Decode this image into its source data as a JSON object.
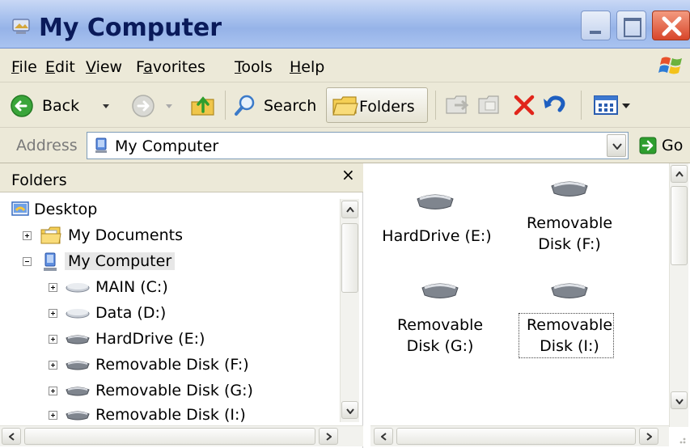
{
  "window": {
    "title": "My Computer",
    "controls": {
      "minimize": "minimize",
      "maximize": "maximize",
      "close": "close"
    }
  },
  "menu": {
    "items": [
      {
        "key": "F",
        "rest": "ile"
      },
      {
        "key": "E",
        "rest": "dit"
      },
      {
        "key": "V",
        "rest": "iew"
      },
      {
        "pre": "F",
        "key": "a",
        "rest": "vorites"
      },
      {
        "key": "T",
        "rest": "ools"
      },
      {
        "key": "H",
        "rest": "elp"
      }
    ]
  },
  "toolbar": {
    "back_label": "Back",
    "search_label": "Search",
    "folders_label": "Folders"
  },
  "address": {
    "label": "Address",
    "value": "My Computer",
    "go_label": "Go"
  },
  "folders_pane": {
    "title": "Folders",
    "close_glyph": "×",
    "tree": [
      {
        "label": "Desktop"
      },
      {
        "label": "My Documents"
      },
      {
        "label": "My Computer"
      },
      {
        "label": "MAIN (C:)"
      },
      {
        "label": "Data (D:)"
      },
      {
        "label": "HardDrive (E:)"
      },
      {
        "label": "Removable Disk (F:)"
      },
      {
        "label": "Removable Disk (G:)"
      },
      {
        "label": "Removable Disk (I:)"
      }
    ]
  },
  "content": {
    "drives": [
      {
        "line1": "HardDrive (E:)",
        "line2": ""
      },
      {
        "line1": "Removable",
        "line2": "Disk (F:)"
      },
      {
        "line1": "Removable",
        "line2": "Disk (G:)"
      },
      {
        "line1": "Removable",
        "line2": "Disk (I:)"
      }
    ]
  },
  "colors": {
    "titlebar": "#a9c2ee",
    "chrome": "#ece9d8",
    "close_button": "#d8462a",
    "address_border": "#7f9db9"
  }
}
